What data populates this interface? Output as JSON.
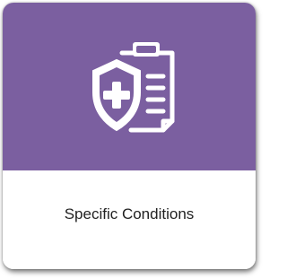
{
  "card": {
    "label": "Specific Conditions",
    "icon": "shield-medical-clipboard-icon",
    "header_color": "#7b5fa0",
    "icon_color": "#ffffff"
  }
}
